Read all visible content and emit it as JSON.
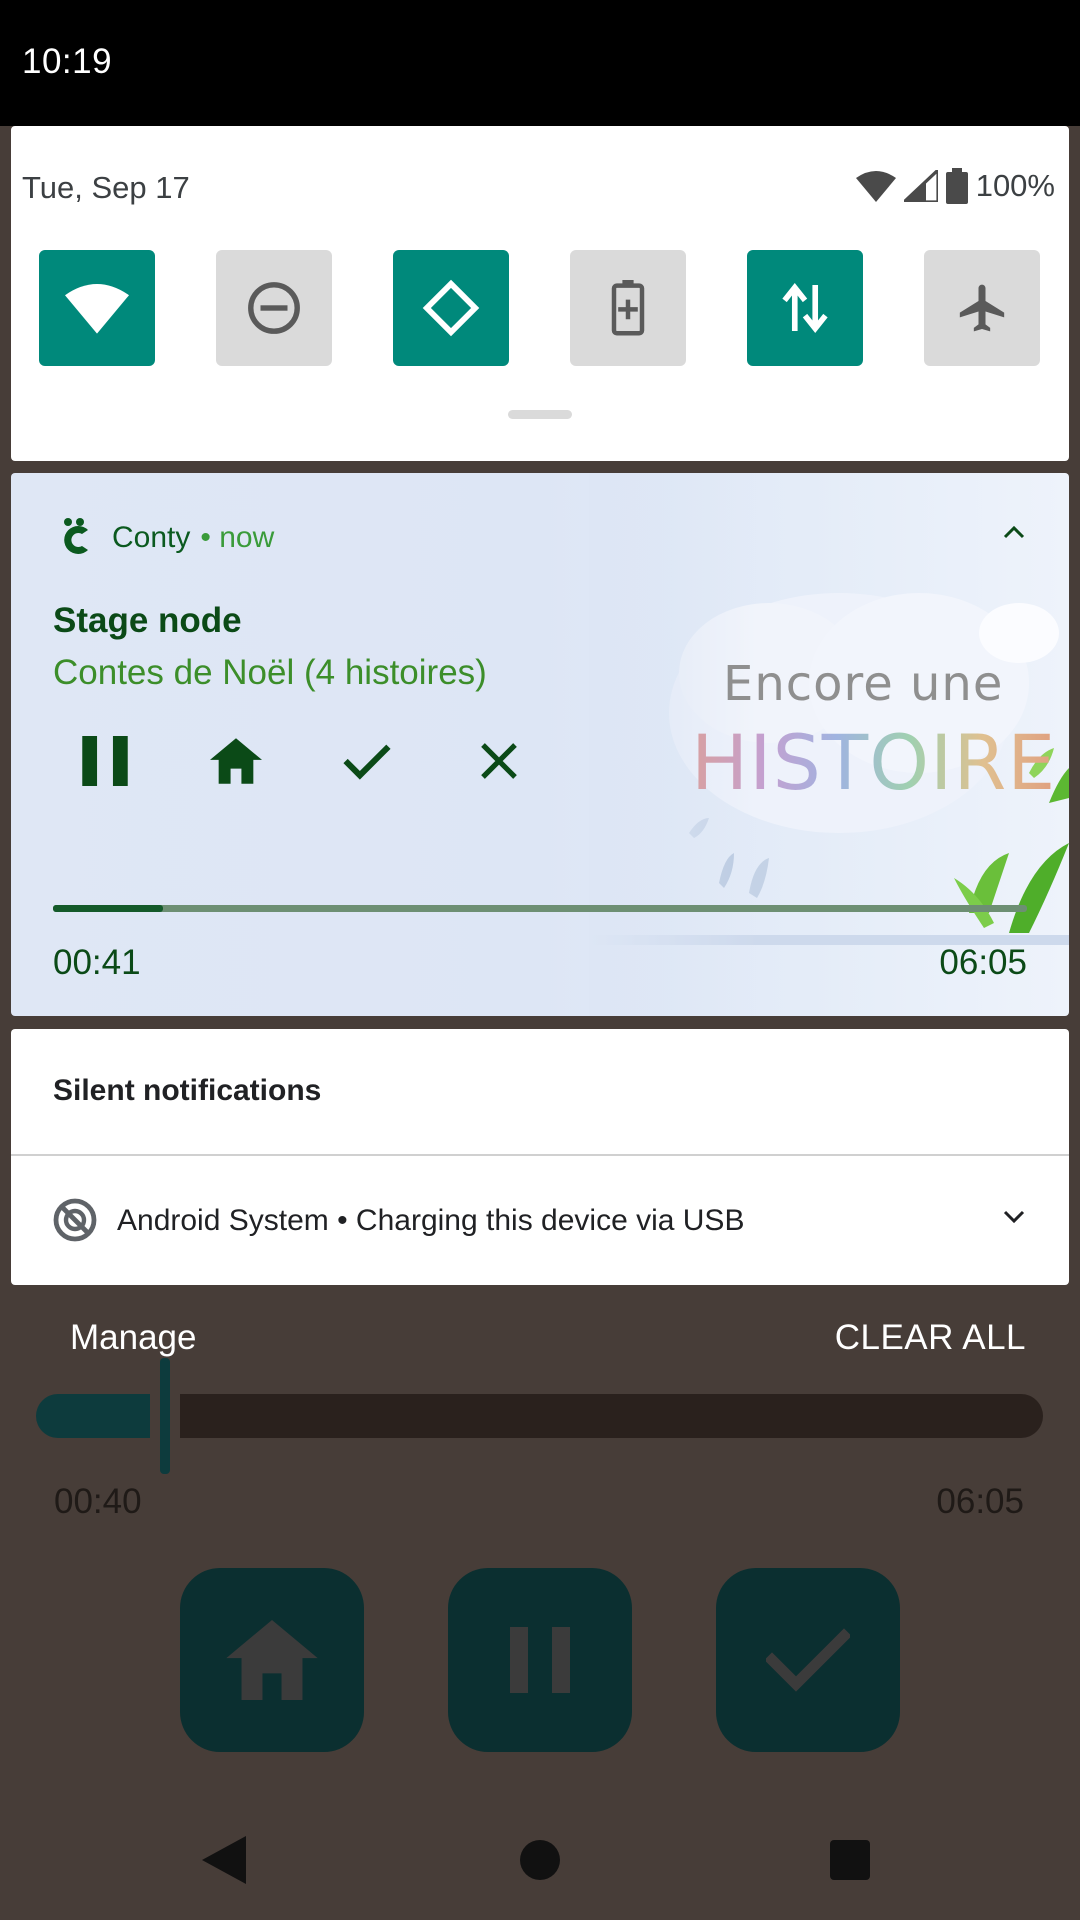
{
  "status_bar": {
    "time": "10:19"
  },
  "quick_settings": {
    "date": "Tue, Sep 17",
    "battery_percent": "100%",
    "tiles": [
      {
        "icon": "wifi-icon",
        "active": true
      },
      {
        "icon": "do-not-disturb-icon",
        "active": false
      },
      {
        "icon": "auto-rotate-icon",
        "active": true
      },
      {
        "icon": "battery-saver-icon",
        "active": false
      },
      {
        "icon": "mobile-data-icon",
        "active": true
      },
      {
        "icon": "airplane-mode-icon",
        "active": false
      }
    ]
  },
  "media_notification": {
    "app_name": "Conty",
    "time_label": "• now",
    "title": "Stage node",
    "subtitle": "Contes de Noël (4 histoires)",
    "actions": [
      "pause-icon",
      "home-icon",
      "check-icon",
      "close-icon"
    ],
    "artwork_text_line1": "Encore une",
    "artwork_text_line2": "HISTOIRE",
    "elapsed": "00:41",
    "duration": "06:05",
    "progress_fraction": 0.113
  },
  "silent_section": {
    "header": "Silent notifications",
    "notification": "Android System • Charging this device via USB"
  },
  "shade_footer": {
    "manage": "Manage",
    "clear_all": "CLEAR ALL"
  },
  "background_app": {
    "elapsed": "00:40",
    "duration": "06:05",
    "buttons": [
      "home-icon",
      "pause-icon",
      "check-icon"
    ]
  },
  "colors": {
    "tile_on": "#00897b",
    "tile_off": "#dadada",
    "media_green": "#0b4a17",
    "scrim": "#473d38"
  }
}
